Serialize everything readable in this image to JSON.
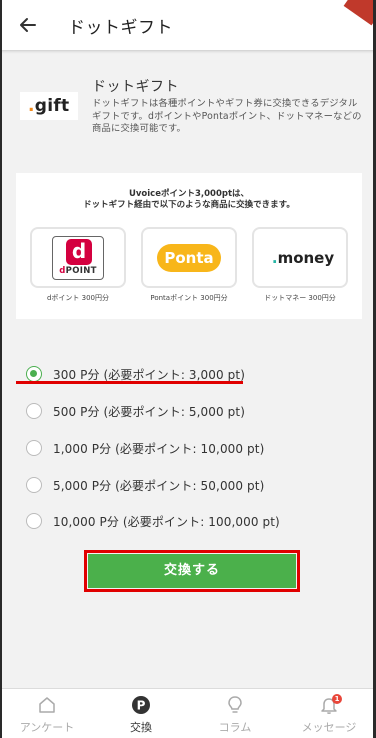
{
  "header": {
    "title": "ドットギフト",
    "back_icon": "arrow-left-icon"
  },
  "intro": {
    "logo_dot": ".",
    "logo_text": "gift",
    "title": "ドットギフト",
    "description": "ドットギフトは各種ポイントやギフト券に交換できるデジタルギフトです。dポイントやPontaポイント、ドットマネーなどの商品に交換可能です。"
  },
  "panel": {
    "heading_line1": "Uvoiceポイント3,000ptは、",
    "heading_line2": "ドットギフト経由で以下のような商品に交換できます。",
    "cards": [
      {
        "logo_main": "d",
        "logo_sub_d": "d",
        "logo_sub_rest": "POINT",
        "label": "dポイント 300円分"
      },
      {
        "logo_main": "Ponta",
        "label": "Pontaポイント 300円分"
      },
      {
        "logo_dot": ".",
        "logo_main": "money",
        "label": "ドットマネー 300円分"
      }
    ]
  },
  "options": [
    {
      "label": "300 P分 (必要ポイント: 3,000 pt)",
      "selected": true
    },
    {
      "label": "500 P分 (必要ポイント: 5,000 pt)",
      "selected": false
    },
    {
      "label": "1,000 P分 (必要ポイント: 10,000 pt)",
      "selected": false
    },
    {
      "label": "5,000 P分 (必要ポイント: 50,000 pt)",
      "selected": false
    },
    {
      "label": "10,000 P分 (必要ポイント: 100,000 pt)",
      "selected": false
    }
  ],
  "exchange_button": {
    "label": "交換する"
  },
  "nav": {
    "items": [
      {
        "label": "アンケート",
        "icon": "house-icon",
        "active": false
      },
      {
        "label": "交換",
        "icon": "point-p-icon",
        "active": true
      },
      {
        "label": "コラム",
        "icon": "lightbulb-icon",
        "active": false
      },
      {
        "label": "メッセージ",
        "icon": "bell-icon",
        "active": false,
        "badge": "1"
      }
    ]
  },
  "colors": {
    "accent_green": "#4bb04b",
    "highlight_red": "#e00000",
    "dpoint_red": "#d4003f",
    "ponta_yellow": "#f8b61a",
    "money_teal": "#26b5a5"
  }
}
